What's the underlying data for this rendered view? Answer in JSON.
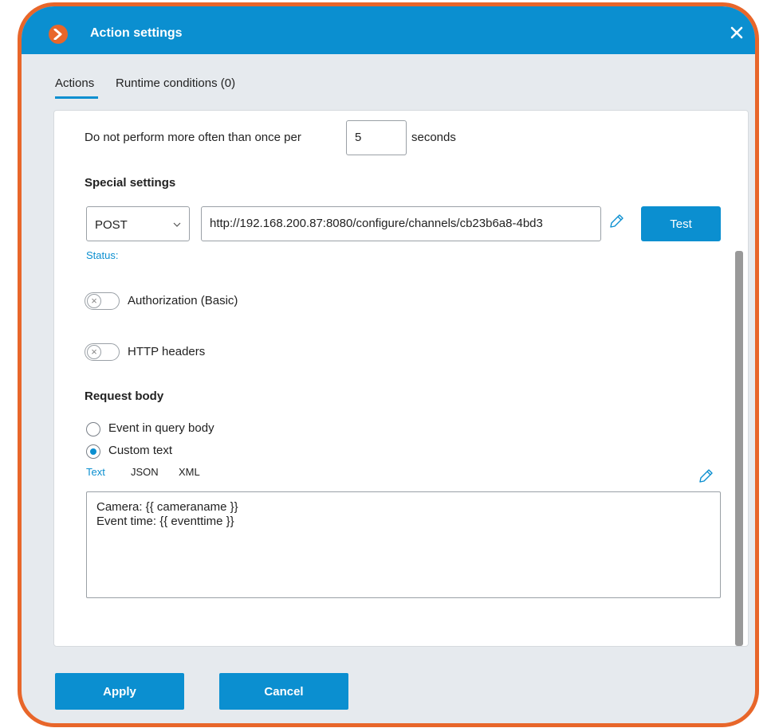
{
  "window": {
    "title": "Action settings",
    "close_icon": "close-icon",
    "logo_icon": "chevron-right-icon",
    "accent_color": "#0b8fd0",
    "frame_color": "#e8662a"
  },
  "tabs": [
    {
      "label": "Actions",
      "active": true
    },
    {
      "label": "Runtime conditions (0)",
      "active": false
    }
  ],
  "throttle": {
    "prefix": "Do not perform more often than once per",
    "value": "5",
    "suffix": "seconds"
  },
  "special": {
    "heading": "Special settings",
    "method": "POST",
    "url": "http://192.168.200.87:8080/configure/channels/cb23b6a8-4bd3",
    "test_label": "Test",
    "status_label": "Status:"
  },
  "toggles": [
    {
      "label": "Authorization (Basic)",
      "on": false
    },
    {
      "label": "HTTP headers",
      "on": false
    }
  ],
  "request_body": {
    "heading": "Request body",
    "options": [
      {
        "label": "Event in query body",
        "checked": false
      },
      {
        "label": "Custom text",
        "checked": true
      }
    ],
    "formats": [
      {
        "label": "Text",
        "active": true
      },
      {
        "label": "JSON",
        "active": false
      },
      {
        "label": "XML",
        "active": false
      }
    ],
    "lines": [
      "Camera: {{ cameraname }}",
      "Event time: {{ eventtime }}"
    ]
  },
  "footer": {
    "apply_label": "Apply",
    "cancel_label": "Cancel"
  }
}
